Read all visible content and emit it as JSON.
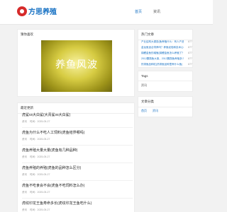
{
  "header": {
    "logo_text": "方思养殖",
    "nav": [
      {
        "label": "首页"
      },
      {
        "label": "资讯"
      }
    ]
  },
  "banner_card": {
    "title": "猜你喜欢",
    "banner_text": "养鱼风波"
  },
  "list_card": {
    "title": "最近更新",
    "posts": [
      {
        "title": "虎鲨vs大白鲨(大青鲨vs大白鲨)",
        "category": "资讯",
        "date": "时间：2025-05-27"
      },
      {
        "title": "虎鱼为什么不吃人工饲料(虎鱼结界哪吗)",
        "category": "资讯",
        "date": "时间：2025-05-27"
      },
      {
        "title": "虎鱼养殖大量大量(虎鱼有几种品种)",
        "category": "资讯",
        "date": "时间：2025-05-27"
      },
      {
        "title": "虎鱼养殖的养殖(虎鱼的品种怎么区分)",
        "category": "资讯",
        "date": "时间：2025-05-27"
      },
      {
        "title": "虎鱼不吃食会不会(虎鱼不吃饲料怎么办)",
        "category": "资讯",
        "date": "时间：2025-05-27"
      },
      {
        "title": "虎纹印龙王鱼寿命多长(虎纹印龙王鱼吃什么)",
        "category": "资讯",
        "date": "时间：2025-05-27"
      }
    ]
  },
  "hot_card": {
    "title": "热门文章",
    "items": [
      {
        "label": "产业结构大调查(鱼养殖什么：有人产品改造)",
        "count": "877"
      },
      {
        "label": "金龙鱼适合饲养吗？养鱼经验和技术心得",
        "count": "877"
      },
      {
        "label": "锦鲤金鱼的增殖(锦鲤金鱼怎么养殖了？)",
        "count": "877"
      },
      {
        "label": "2012鹦鹉鱼大事，2012鹦鹉鱼养殖多少钱",
        "count": "877"
      },
      {
        "label": "热带鱼品种缸(热带鱼品种里养什么鱼)",
        "count": "877"
      }
    ]
  },
  "tags_card": {
    "title": "Tags",
    "tag": "资讯"
  },
  "cats_card": {
    "title": "文章分类",
    "items": [
      {
        "label": "首页"
      },
      {
        "label": "资讯"
      }
    ]
  }
}
